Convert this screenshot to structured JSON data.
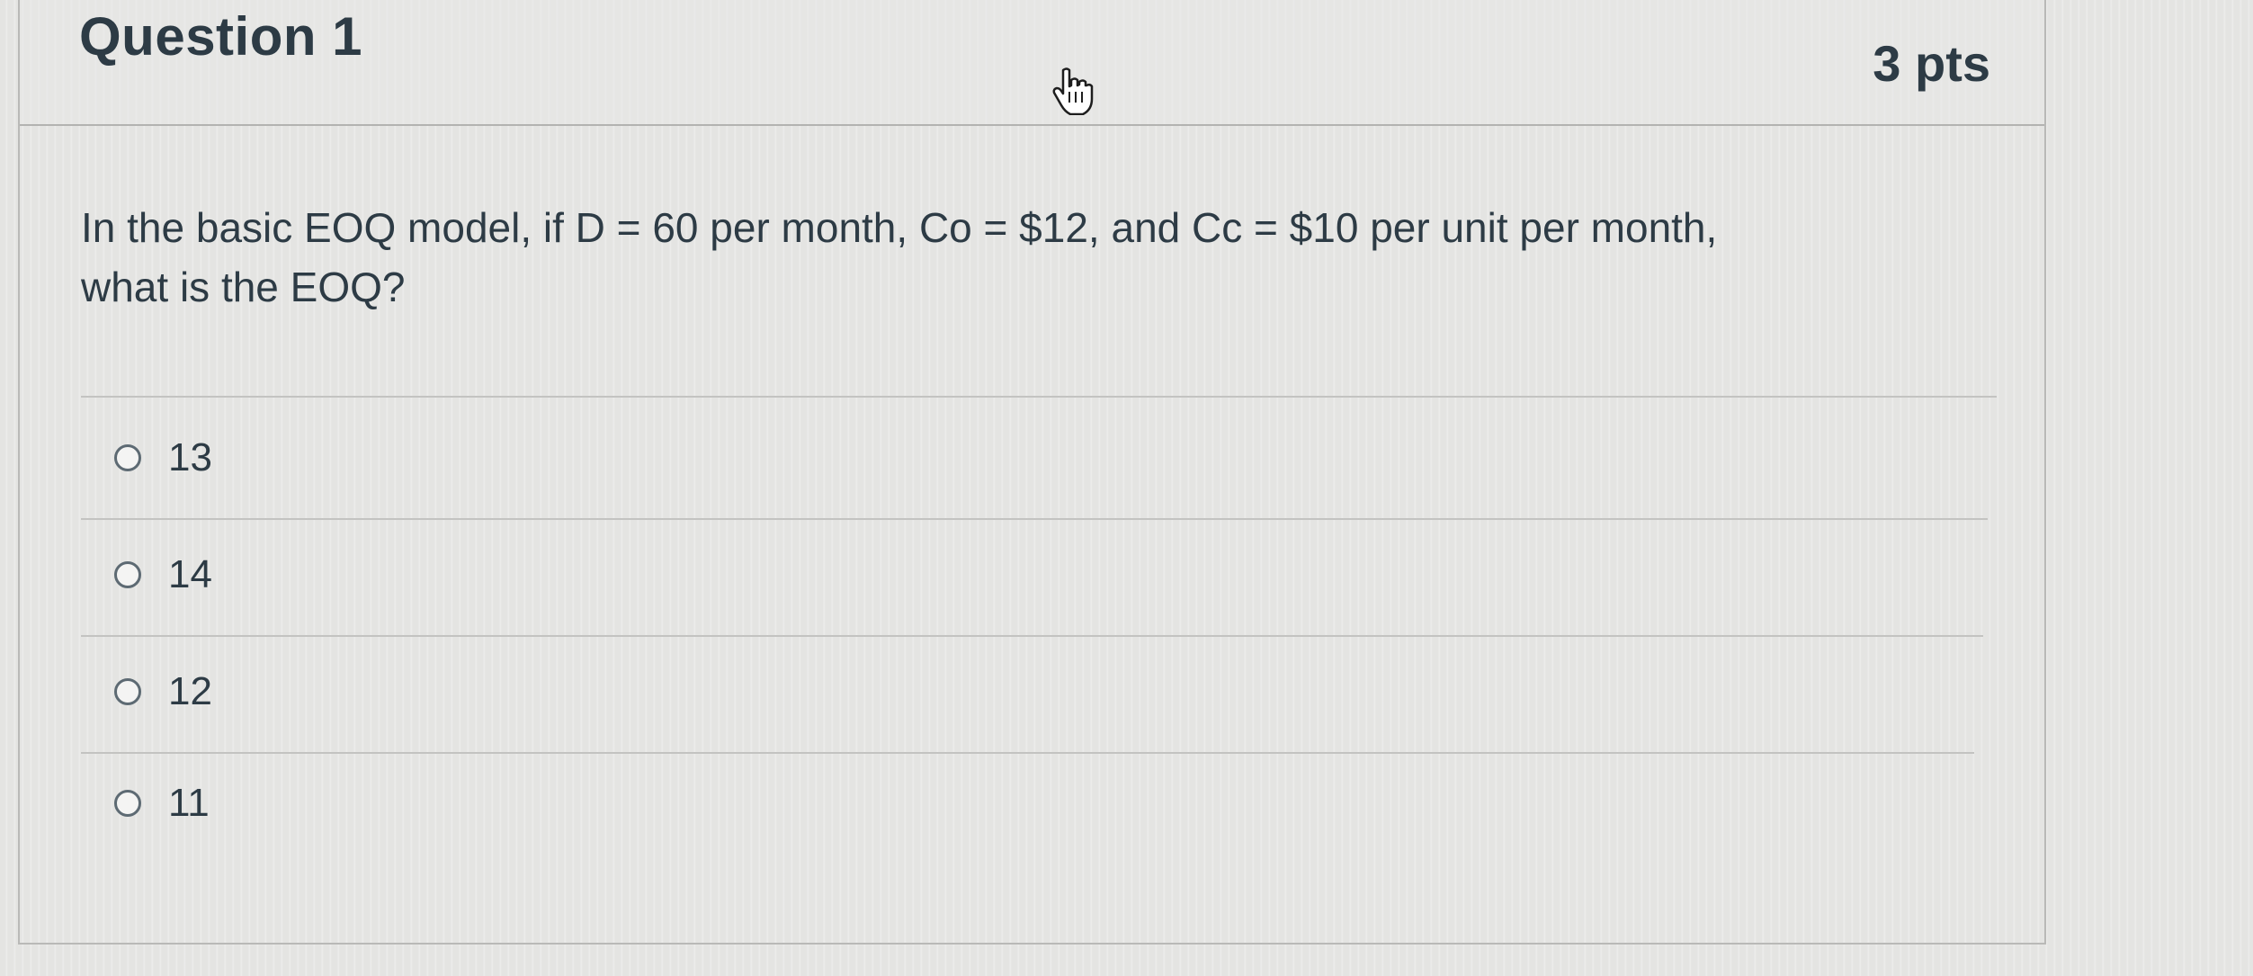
{
  "question": {
    "title": "Question 1",
    "points": "3 pts",
    "text_line1": "In the basic EOQ model, if D = 60 per month, Co = $12, and Cc = $10 per unit per month,",
    "text_line2": "what is the EOQ?"
  },
  "answers": [
    {
      "label": "13"
    },
    {
      "label": "14"
    },
    {
      "label": "12"
    },
    {
      "label": "11"
    }
  ],
  "icons": {
    "cursor": "hand-pointer-icon",
    "answer_control": "radio-button"
  },
  "colors": {
    "text": "#2d3b45",
    "background": "#e4e4e2",
    "divider": "#c3c3c1"
  }
}
